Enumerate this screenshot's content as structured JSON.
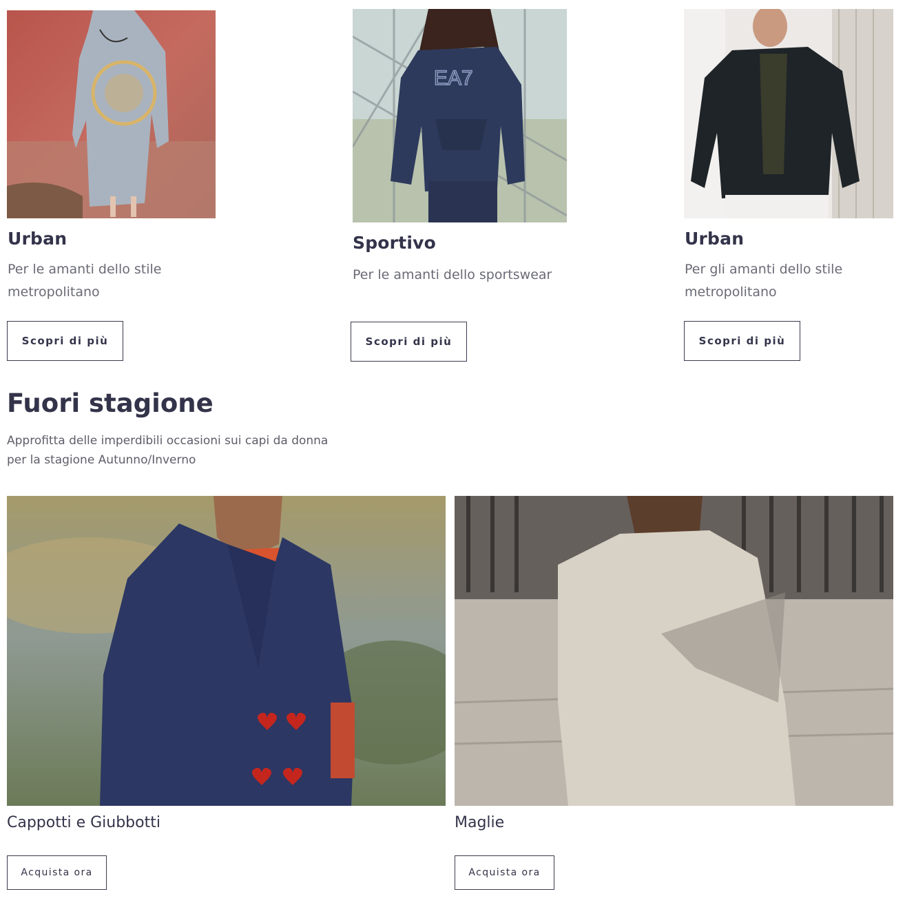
{
  "cards": [
    {
      "title": "Urban",
      "description": "Per le amanti dello stile metropolitano",
      "button": "Scopri di più"
    },
    {
      "title": "Sportivo",
      "description": "Per le amanti dello sportswear",
      "button": "Scopri di più"
    },
    {
      "title": "Urban",
      "description": "Per gli amanti dello stile metropolitano",
      "button": "Scopri di più"
    }
  ],
  "section": {
    "title": "Fuori stagione",
    "description": "Approfitta delle imperdibili occasioni sui capi da donna per la stagione Autunno/Inverno"
  },
  "categories": [
    {
      "title": "Cappotti e Giubbotti",
      "button": "Acquista ora"
    },
    {
      "title": "Maglie",
      "button": "Acquista ora"
    }
  ],
  "colors": {
    "text": "#33334a",
    "muted": "#6a6a76",
    "border": "#3a3a4e"
  }
}
